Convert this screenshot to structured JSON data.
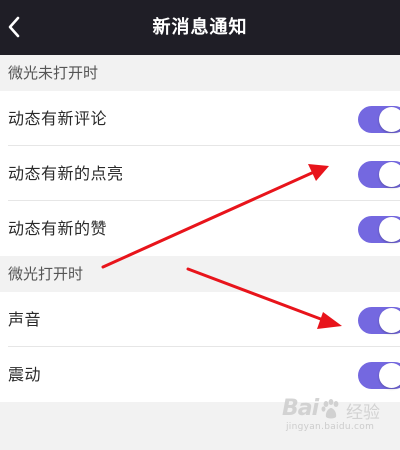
{
  "header": {
    "back_icon": "chevron-left-icon",
    "title": "新消息通知"
  },
  "sections": [
    {
      "title": "微光未打开时",
      "items": [
        {
          "label": "动态有新评论",
          "enabled": true
        },
        {
          "label": "动态有新的点亮",
          "enabled": true
        },
        {
          "label": "动态有新的赞",
          "enabled": true
        }
      ]
    },
    {
      "title": "微光打开时",
      "items": [
        {
          "label": "声音",
          "enabled": true
        },
        {
          "label": "震动",
          "enabled": true
        }
      ]
    }
  ],
  "watermark": {
    "logo": "Bai",
    "paw_icon": "baidu-paw-icon",
    "text": "经验",
    "url": "jingyan.baidu.com"
  },
  "colors": {
    "header_bg": "#1f1e26",
    "toggle_on": "#7468e0",
    "arrow": "#e8141b",
    "page_bg": "#f2f2f2"
  }
}
